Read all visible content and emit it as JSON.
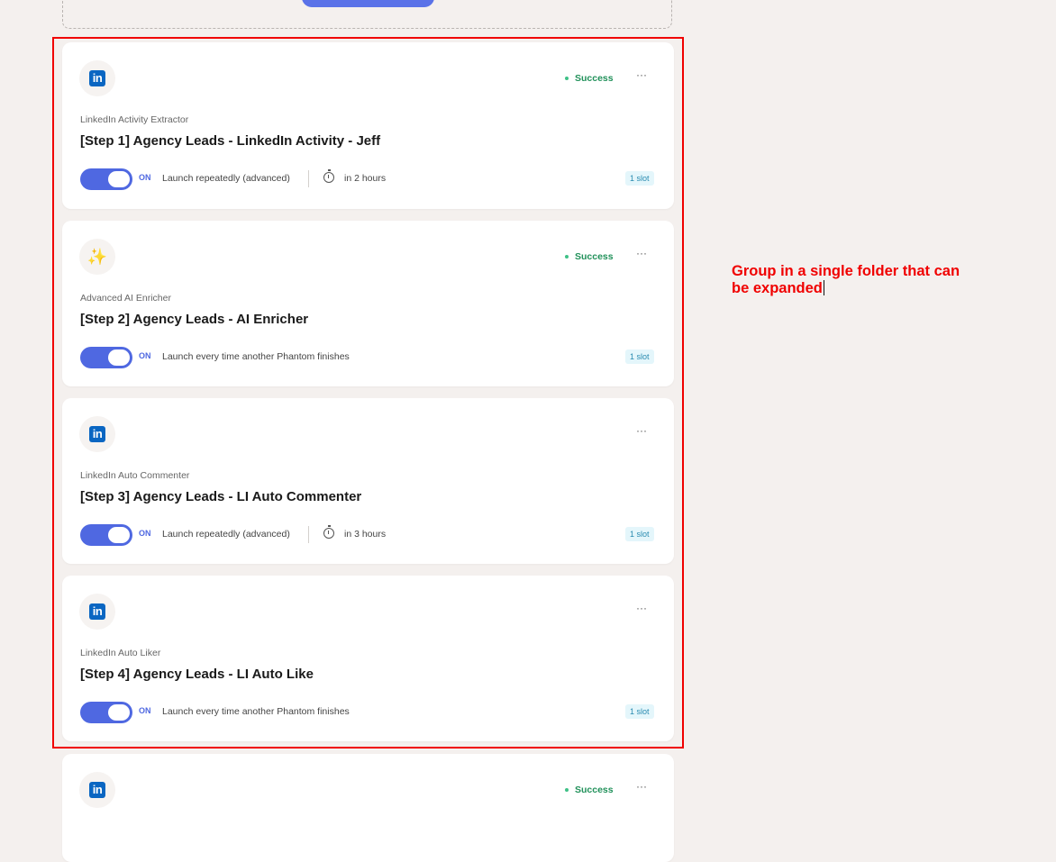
{
  "cards": [
    {
      "icon": "linkedin-icon",
      "icon_glyph": "in",
      "status": "Success",
      "subtitle": "LinkedIn Activity Extractor",
      "title": "[Step 1] Agency Leads - LinkedIn Activity - Jeff",
      "toggle": "ON",
      "launch": "Launch repeatedly (advanced)",
      "next_run": "in 2 hours",
      "slot": "1 slot"
    },
    {
      "icon": "sparkles-icon",
      "icon_glyph": "✨",
      "status": "Success",
      "subtitle": "Advanced AI Enricher",
      "title": "[Step 2] Agency Leads - AI Enricher",
      "toggle": "ON",
      "launch": "Launch every time another Phantom finishes",
      "slot": "1 slot"
    },
    {
      "icon": "linkedin-icon",
      "icon_glyph": "in",
      "subtitle": "LinkedIn Auto Commenter",
      "title": "[Step 3] Agency Leads - LI Auto Commenter",
      "toggle": "ON",
      "launch": "Launch repeatedly (advanced)",
      "next_run": "in 3 hours",
      "slot": "1 slot"
    },
    {
      "icon": "linkedin-icon",
      "icon_glyph": "in",
      "subtitle": "LinkedIn Auto Liker",
      "title": "[Step 4] Agency Leads - LI Auto Like",
      "toggle": "ON",
      "launch": "Launch every time another Phantom finishes",
      "slot": "1 slot"
    },
    {
      "icon": "linkedin-icon",
      "icon_glyph": "in",
      "status": "Success"
    }
  ],
  "more_glyph": "···",
  "annotation": {
    "text": "Group in a single folder that can be expanded",
    "color": "#f00000"
  },
  "colors": {
    "accent": "#4f68e1",
    "success": "#21915a",
    "linkedin": "#0a66c2",
    "highlight_border": "#f00000"
  }
}
